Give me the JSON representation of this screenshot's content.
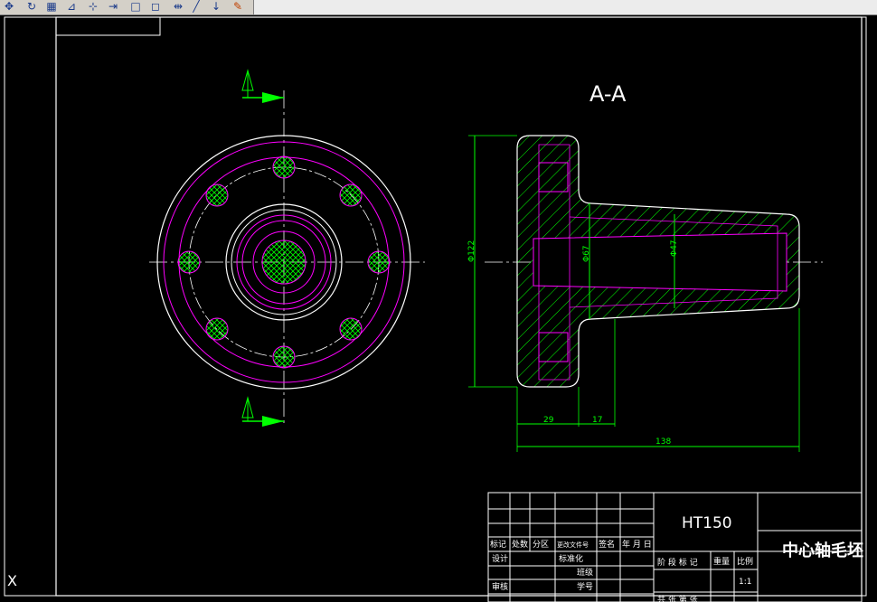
{
  "toolbar": {
    "icons": [
      "pan-icon",
      "orbit-icon",
      "grid-icon",
      "align-icon",
      "trim-icon",
      "extend-icon",
      "rectangle-icon",
      "square-icon",
      "move-icon",
      "draw-icon",
      "pin-icon",
      "erase-icon"
    ],
    "glyphs": [
      "✥",
      "↻",
      "▦",
      "⊿",
      "⊹",
      "⇥",
      "□",
      "◻",
      "⇹",
      "╱",
      "↓",
      "✎"
    ]
  },
  "drawing": {
    "section_label": "A-A",
    "cut_label_top": "A",
    "cut_label_bottom": "A",
    "dim_phi122": "Φ122",
    "dim_phi67": "Φ67",
    "dim_phi47": "Φ47",
    "dim_29": "29",
    "dim_17": "17",
    "dim_138": "138"
  },
  "title_block": {
    "material": "HT150",
    "part_name": "中心轴毛坯",
    "headers": {
      "mark": "标记",
      "count": "处数",
      "zone": "分区",
      "change_doc": "更改文件号",
      "signature": "签名",
      "date": "年 月 日"
    },
    "rows": {
      "design": "设计",
      "standardize": "标准化",
      "class": "班级",
      "student_id": "学号",
      "review": "审核"
    },
    "stage_label": "阶 段 标 记",
    "weight_label": "重量",
    "scale_label": "比例",
    "scale_value": "1:1",
    "sheet_labels": "共 张 第 张"
  },
  "status": {
    "x_axis_label": "X"
  },
  "colors": {
    "background": "#000000",
    "white": "#ffffff",
    "magenta": "#ff00ff",
    "green": "#00ff00",
    "toolbar": "#d4d0c8"
  }
}
